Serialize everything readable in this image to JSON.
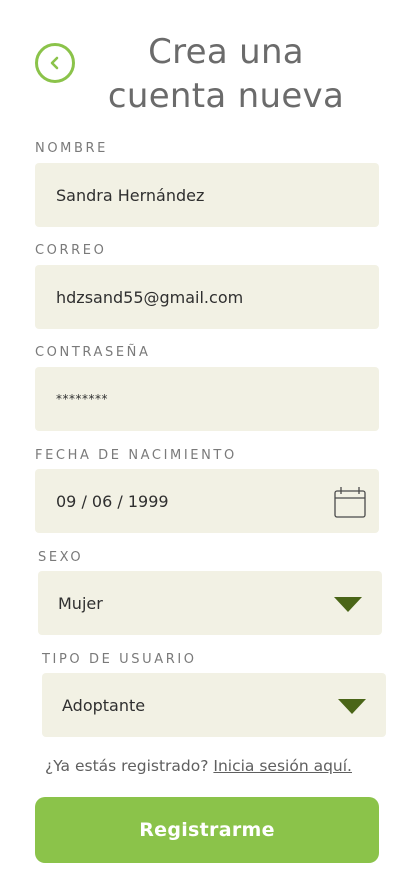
{
  "header": {
    "title_line1": "Crea una",
    "title_line2": "cuenta nueva",
    "back_icon": "chevron-left-icon"
  },
  "form": {
    "name": {
      "label": "NOMBRE",
      "value": "Sandra Hernández"
    },
    "email": {
      "label": "CORREO",
      "value": "hdzsand55@gmail.com"
    },
    "password": {
      "label": "CONTRASEÑA",
      "value": "********"
    },
    "birthdate": {
      "label": "FECHA DE NACIMIENTO",
      "value": "09 / 06 / 1999",
      "icon": "calendar-icon"
    },
    "sex": {
      "label": "SEXO",
      "value": "Mujer",
      "icon": "caret-down-icon"
    },
    "user_type": {
      "label": "TIPO DE USUARIO",
      "value": "Adoptante",
      "icon": "caret-down-icon"
    }
  },
  "footer": {
    "login_prompt": "¿Ya estás registrado?",
    "login_link": "Inicia sesión aquí.",
    "register_button": "Registrarme"
  },
  "colors": {
    "accent_green": "#8bc34a",
    "dark_green": "#4a6517",
    "field_background": "#f2f1e4",
    "title_gray": "#6b6b6b"
  }
}
